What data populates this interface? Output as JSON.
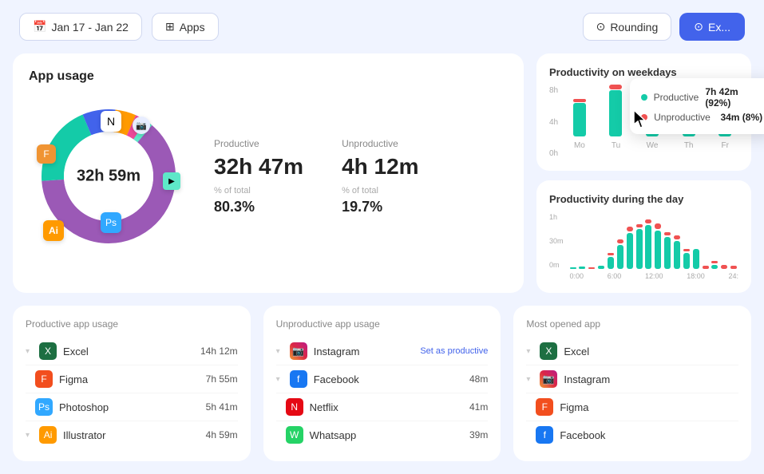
{
  "header": {
    "date_range": "Jan 17 - Jan 22",
    "apps_label": "Apps",
    "rounding_label": "Rounding",
    "export_label": "Ex..."
  },
  "app_usage": {
    "title": "App usage",
    "total_time": "32h 59m",
    "productive": {
      "label": "Productive",
      "value": "32h 47m",
      "percent_label": "% of total",
      "percent": "80.3%"
    },
    "unproductive": {
      "label": "Unproductive",
      "value": "4h 12m",
      "percent_label": "% of total",
      "percent": "19.7%"
    }
  },
  "weekday_chart": {
    "title": "Productivity on weekdays",
    "y_labels": [
      "8h",
      "4h",
      "0h"
    ],
    "days": [
      "Mo",
      "Tu",
      "We",
      "Th",
      "Fr"
    ],
    "tooltip": {
      "productive_label": "Productive",
      "productive_value": "7h 42m (92%)",
      "unproductive_label": "Unproductive",
      "unproductive_value": "34m (8%)"
    }
  },
  "day_chart": {
    "title": "Productivity during the day",
    "y_labels": [
      "1h",
      "30m",
      "0m"
    ],
    "x_labels": [
      "0:00",
      "6:00",
      "12:00",
      "18:00",
      "24:"
    ]
  },
  "productive_apps": {
    "title": "Productive app usage",
    "items": [
      {
        "name": "Excel",
        "time": "14h 12m",
        "icon": "excel"
      },
      {
        "name": "Figma",
        "time": "7h 55m",
        "icon": "figma"
      },
      {
        "name": "Photoshop",
        "time": "5h 41m",
        "icon": "ps"
      },
      {
        "name": "Illustrator",
        "time": "4h 59m",
        "icon": "ai"
      }
    ]
  },
  "unproductive_apps": {
    "title": "Unproductive app usage",
    "items": [
      {
        "name": "Instagram",
        "time": "",
        "set_productive": "Set as productive",
        "icon": "instagram"
      },
      {
        "name": "Facebook",
        "time": "48m",
        "icon": "facebook"
      },
      {
        "name": "Netflix",
        "time": "41m",
        "icon": "netflix"
      },
      {
        "name": "Whatsapp",
        "time": "39m",
        "icon": "whatsapp"
      }
    ]
  },
  "most_opened": {
    "title": "Most opened app",
    "items": [
      {
        "name": "Excel",
        "icon": "excel"
      },
      {
        "name": "Instagram",
        "icon": "instagram"
      },
      {
        "name": "Figma",
        "icon": "figma"
      },
      {
        "name": "Facebook",
        "icon": "facebook"
      }
    ]
  },
  "colors": {
    "teal": "#14cba8",
    "red": "#f05252",
    "blue": "#4263eb",
    "purple": "#9b59b6",
    "orange": "#ff9a00"
  }
}
